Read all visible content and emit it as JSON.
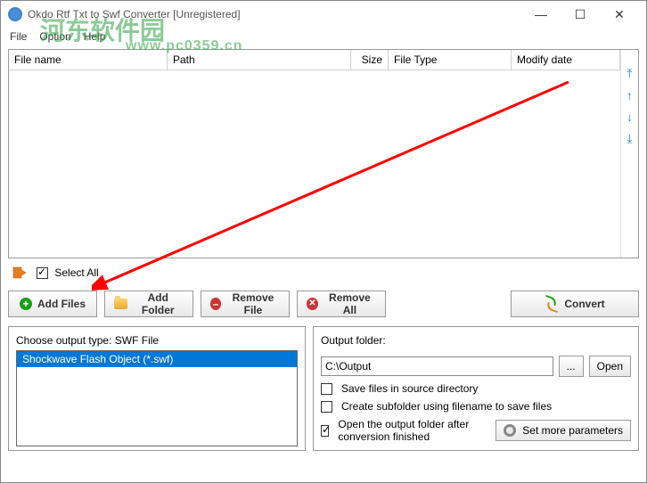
{
  "window": {
    "title": "Okdo Rtf Txt to Swf Converter  [Unregistered]"
  },
  "menu": {
    "file": "File",
    "option": "Option",
    "help": "Help"
  },
  "watermark": {
    "line1": "河东软件园",
    "line2": "www.pc0359.cn"
  },
  "table": {
    "headers": {
      "name": "File name",
      "path": "Path",
      "size": "Size",
      "type": "File Type",
      "date": "Modify date"
    }
  },
  "selectAll": {
    "label": "Select All"
  },
  "buttons": {
    "addFiles": "Add Files",
    "addFolder": "Add Folder",
    "removeFile": "Remove File",
    "removeAll": "Remove All",
    "convert": "Convert"
  },
  "outputType": {
    "label": "Choose output type:  SWF File",
    "item": "Shockwave Flash Object (*.swf)"
  },
  "outputFolder": {
    "label": "Output folder:",
    "path": "C:\\Output",
    "browse": "...",
    "open": "Open"
  },
  "options": {
    "saveSource": "Save files in source directory",
    "createSub": "Create subfolder using filename to save files",
    "openAfter": "Open the output folder after conversion finished"
  },
  "setMore": "Set more parameters"
}
